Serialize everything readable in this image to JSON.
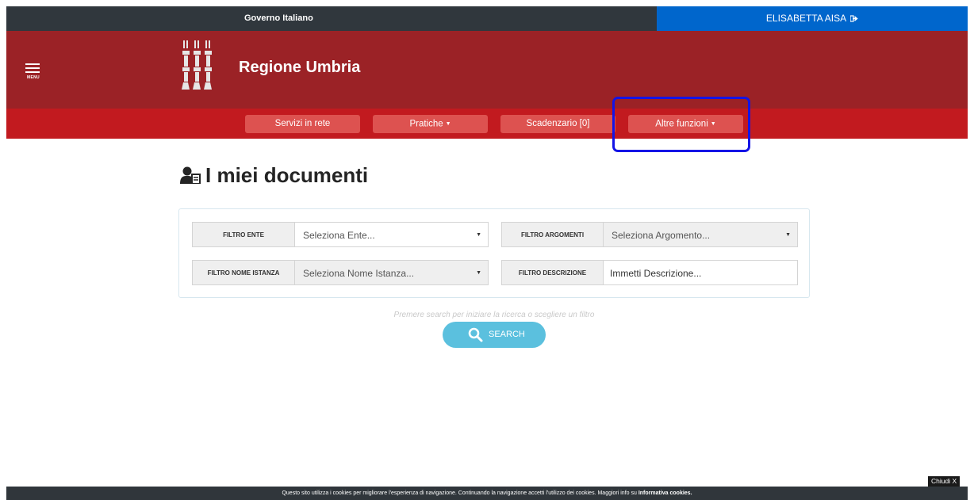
{
  "topbar": {
    "gov_label": "Governo Italiano",
    "user_name": "ELISABETTA AISA",
    "user_icon": "logout-icon",
    "user_bg": "#0066cc"
  },
  "header": {
    "menu_label": "MENU",
    "title": "Regione Umbria",
    "bg": "#9b2226"
  },
  "nav": {
    "items": [
      {
        "label": "Servizi in rete",
        "dropdown": false
      },
      {
        "label": "Pratiche",
        "dropdown": true
      },
      {
        "label": "Scadenzario [0]",
        "dropdown": false
      },
      {
        "label": "Altre funzioni",
        "dropdown": true
      }
    ],
    "bg": "#c21a1f",
    "button_bg": "#dd5250",
    "highlight_color": "#1414e6"
  },
  "page": {
    "title": "I miei documenti",
    "title_icon": "user-document-icon"
  },
  "filters": {
    "ente": {
      "label": "FILTRO ENTE",
      "value": "Seleziona Ente..."
    },
    "argomenti": {
      "label": "FILTRO ARGOMENTI",
      "value": "Seleziona Argomento..."
    },
    "nome_istanza": {
      "label": "FILTRO NOME ISTANZA",
      "value": "Seleziona Nome Istanza..."
    },
    "descrizione": {
      "label": "FILTRO DESCRIZIONE",
      "placeholder": "Immetti Descrizione..."
    }
  },
  "search": {
    "hint": "Premere search per iniziare la ricerca o scegliere un filtro",
    "button_label": "SEARCH",
    "button_color": "#5bc0de"
  },
  "cookie": {
    "close_label": "Chiudi X",
    "text": "Questo sito utilizza i cookies per migliorare l'esperienza di navigazione. Continuando la navigazione accetti l'utilizzo dei cookies. Maggiori info su ",
    "link": "Informativa cookies."
  }
}
